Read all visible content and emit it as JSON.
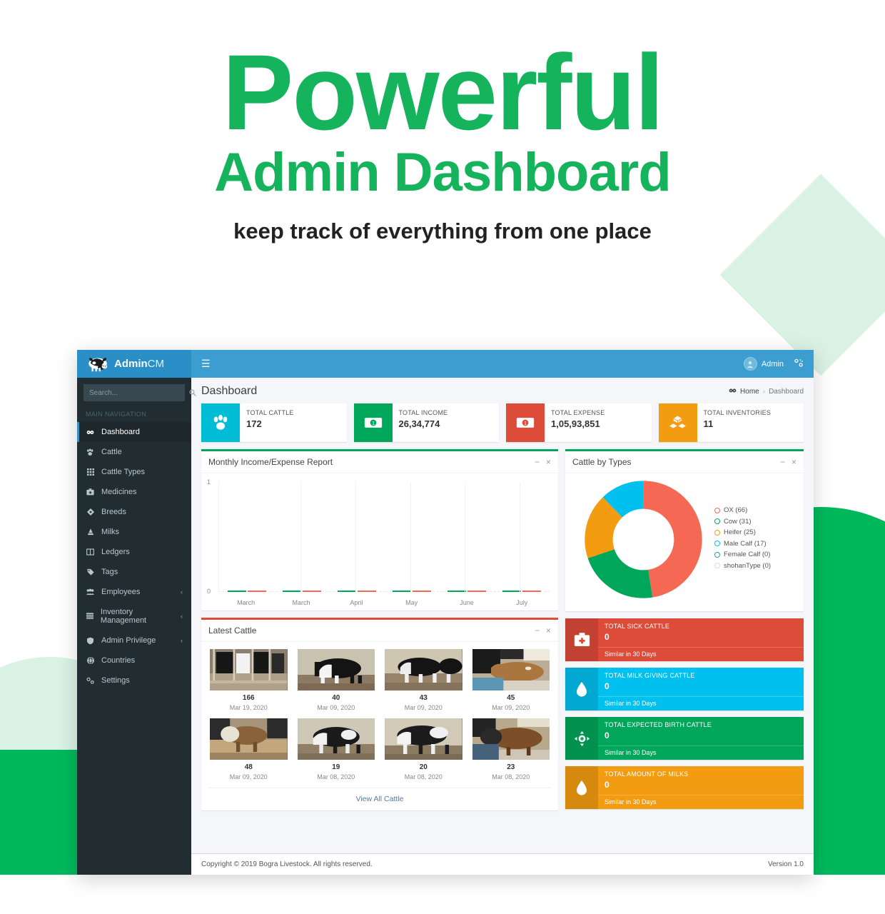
{
  "hero": {
    "title": "Powerful",
    "subtitle": "Admin Dashboard",
    "tagline": "keep track of everything from one place"
  },
  "navbar": {
    "brand_main": "Admin",
    "brand_accent": "CM",
    "menu_toggle": "☰",
    "user_name": "Admin"
  },
  "sidebar": {
    "search_placeholder": "Search...",
    "section_header": "MAIN NAVIGATION",
    "items": [
      {
        "label": "Dashboard",
        "icon": "dashboard-icon",
        "active": true,
        "arrow": ""
      },
      {
        "label": "Cattle",
        "icon": "paw-icon",
        "active": false,
        "arrow": ""
      },
      {
        "label": "Cattle Types",
        "icon": "grid-icon",
        "active": false,
        "arrow": ""
      },
      {
        "label": "Medicines",
        "icon": "medkit-icon",
        "active": false,
        "arrow": ""
      },
      {
        "label": "Breeds",
        "icon": "diamond-icon",
        "active": false,
        "arrow": ""
      },
      {
        "label": "Milks",
        "icon": "flask-icon",
        "active": false,
        "arrow": ""
      },
      {
        "label": "Ledgers",
        "icon": "book-icon",
        "active": false,
        "arrow": ""
      },
      {
        "label": "Tags",
        "icon": "tag-icon",
        "active": false,
        "arrow": ""
      },
      {
        "label": "Employees",
        "icon": "users-icon",
        "active": false,
        "arrow": "‹"
      },
      {
        "label": "Inventory Management",
        "icon": "list-icon",
        "active": false,
        "arrow": "‹"
      },
      {
        "label": "Admin Privilege",
        "icon": "shield-icon",
        "active": false,
        "arrow": "‹"
      },
      {
        "label": "Countries",
        "icon": "globe-icon",
        "active": false,
        "arrow": ""
      },
      {
        "label": "Settings",
        "icon": "cogs-icon",
        "active": false,
        "arrow": ""
      }
    ]
  },
  "page": {
    "title": "Dashboard",
    "breadcrumb_home": "Home",
    "breadcrumb_sep": "›",
    "breadcrumb_current": "Dashboard"
  },
  "stats": [
    {
      "label": "TOTAL CATTLE",
      "value": "172",
      "color": "#00bcd4",
      "icon": "paw-icon"
    },
    {
      "label": "TOTAL INCOME",
      "value": "26,34,774",
      "color": "#00a65a",
      "icon": "money-icon"
    },
    {
      "label": "TOTAL EXPENSE",
      "value": "1,05,93,851",
      "color": "#dd4b39",
      "icon": "money-icon"
    },
    {
      "label": "TOTAL INVENTORIES",
      "value": "11",
      "color": "#f39c12",
      "icon": "boxes-icon"
    }
  ],
  "panels": {
    "income_expense_title": "Monthly Income/Expense Report",
    "cattle_types_title": "Cattle by Types",
    "latest_cattle_title": "Latest Cattle",
    "minimize_icon": "−",
    "close_icon": "×",
    "view_all_label": "View All Cattle"
  },
  "chart_data": [
    {
      "type": "bar",
      "title": "Monthly Income/Expense Report",
      "categories": [
        "March",
        "March",
        "April",
        "May",
        "June",
        "July"
      ],
      "series": [
        {
          "name": "Income",
          "color": "#00a65a",
          "values": [
            0,
            0,
            0,
            0,
            0,
            0
          ]
        },
        {
          "name": "Expense",
          "color": "#f56954",
          "values": [
            0,
            0,
            0,
            0,
            0,
            0
          ]
        }
      ],
      "xlabel": "",
      "ylabel": "",
      "ylim": [
        0,
        1
      ],
      "yticks": [
        "0",
        "1"
      ],
      "grid": true,
      "legend": "none"
    },
    {
      "type": "pie",
      "title": "Cattle by Types",
      "labels": [
        "OX",
        "Cow",
        "Heifer",
        "Male Calf",
        "Female Calf",
        "shohanType"
      ],
      "values": [
        66,
        31,
        25,
        17,
        0,
        0
      ],
      "colors": [
        "#f56954",
        "#00a65a",
        "#f39c12",
        "#00c0ef",
        "#3c8dbc",
        "#d2d6de"
      ],
      "legend": "right",
      "legend_entries": [
        {
          "label": "OX (66)",
          "color": "#f56954"
        },
        {
          "label": "Cow (31)",
          "color": "#00a65a"
        },
        {
          "label": "Heifer (25)",
          "color": "#f39c12"
        },
        {
          "label": "Male Calf (17)",
          "color": "#00c0ef"
        },
        {
          "label": "Female Calf (0)",
          "color": "#3c8dbc"
        },
        {
          "label": "shohanType (0)",
          "color": "#d2d6de"
        }
      ]
    }
  ],
  "latest_cattle": [
    {
      "id": "166",
      "date": "Mar 19, 2020"
    },
    {
      "id": "40",
      "date": "Mar 09, 2020"
    },
    {
      "id": "43",
      "date": "Mar 09, 2020"
    },
    {
      "id": "45",
      "date": "Mar 09, 2020"
    },
    {
      "id": "48",
      "date": "Mar 09, 2020"
    },
    {
      "id": "19",
      "date": "Mar 08, 2020"
    },
    {
      "id": "20",
      "date": "Mar 08, 2020"
    },
    {
      "id": "23",
      "date": "Mar 08, 2020"
    }
  ],
  "info_boxes": [
    {
      "label": "TOTAL SICK CATTLE",
      "value": "0",
      "footer": "Similar in 30 Days",
      "color": "#dd4b39",
      "icon": "medkit-icon"
    },
    {
      "label": "TOTAL MILK GIVING CATTLE",
      "value": "0",
      "footer": "Similar in 30 Days",
      "color": "#00c0ef",
      "icon": "drop-icon"
    },
    {
      "label": "TOTAL EXPECTED BIRTH CATTLE",
      "value": "0",
      "footer": "Similar in 30 Days",
      "color": "#00a65a",
      "icon": "target-icon"
    },
    {
      "label": "TOTAL AMOUNT OF MILKS",
      "value": "0",
      "footer": "Similar in 30 Days",
      "color": "#f39c12",
      "icon": "drop-icon"
    }
  ],
  "footer": {
    "copyright": "Copyright © 2019 Bogra Livestock. All rights reserved.",
    "version": "Version 1.0"
  }
}
